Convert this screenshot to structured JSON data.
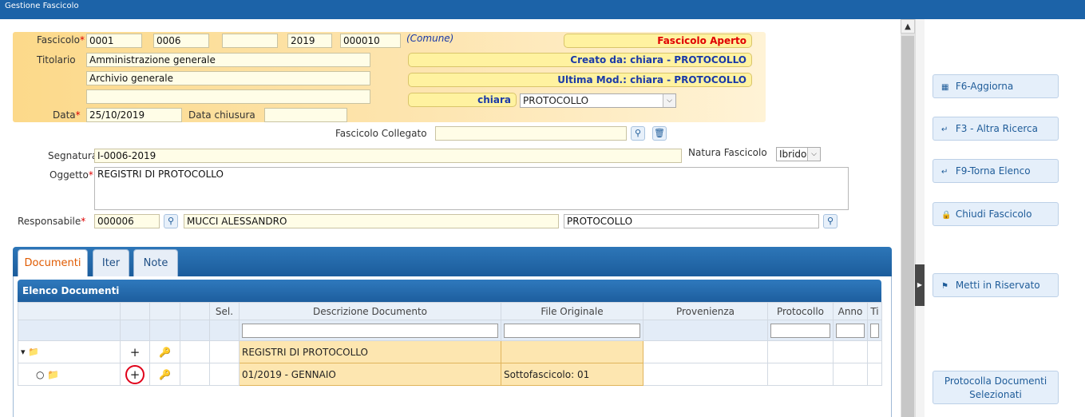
{
  "window": {
    "title": "Gestione Fascicolo"
  },
  "header": {
    "fascicolo_label": "Fascicolo",
    "fascicolo_1": "0001",
    "fascicolo_2": "0006",
    "fascicolo_3": "",
    "anno": "2019",
    "numero": "000010",
    "comune": "(Comune)",
    "stato": "Fascicolo Aperto",
    "titolario_label": "Titolario",
    "titolario_1": "Amministrazione generale",
    "titolario_2": "Archivio generale",
    "titolario_3": "",
    "creato_da": "Creato da: chiara - PROTOCOLLO",
    "ultima_mod": "Ultima Mod.: chiara - PROTOCOLLO",
    "utente": "chiara",
    "ufficio_select": "PROTOCOLLO",
    "data_label": "Data",
    "data_value": "25/10/2019",
    "data_chiusura_label": "Data chiusura",
    "data_chiusura_value": ""
  },
  "form": {
    "collegato_label": "Fascicolo Collegato",
    "collegato_value": "",
    "segnatura_label": "Segnatura",
    "segnatura_value": "I-0006-2019",
    "natura_label": "Natura Fascicolo",
    "natura_value": "Ibrido",
    "oggetto_label": "Oggetto",
    "oggetto_value": "REGISTRI DI PROTOCOLLO",
    "responsabile_label": "Responsabile",
    "responsabile_code": "000006",
    "responsabile_name": "MUCCI ALESSANDRO",
    "responsabile_ufficio": "PROTOCOLLO"
  },
  "tabs": [
    {
      "label": "Documenti",
      "active": true
    },
    {
      "label": "Iter",
      "active": false
    },
    {
      "label": "Note",
      "active": false
    }
  ],
  "grid": {
    "title": "Elenco Documenti",
    "columns": [
      "",
      "",
      "",
      "",
      "Sel.",
      "Descrizione Documento",
      "File Originale",
      "Provenienza",
      "Protocollo",
      "Anno",
      "Ti"
    ],
    "rows": [
      {
        "descrizione": "REGISTRI DI PROTOCOLLO",
        "file": "",
        "provenienza": "",
        "protocollo": "",
        "anno": ""
      },
      {
        "descrizione": "01/2019 - GENNAIO",
        "file": "Sottofascicolo: 01",
        "provenienza": "",
        "protocollo": "",
        "anno": ""
      }
    ]
  },
  "actions": {
    "aggiorna": "F6-Aggiorna",
    "altra_ricerca": "F3 - Altra Ricerca",
    "torna_elenco": "F9-Torna Elenco",
    "chiudi": "Chiudi Fascicolo",
    "riservato": "Metti in Riservato",
    "protocolla_1": "Protocolla Documenti",
    "protocolla_2": "Selezionati"
  },
  "colors": {
    "titlebar": "#1c63a8",
    "accent_red": "#e00000",
    "accent_blue": "#1a3aa8",
    "highlight_circle": "#e0001a"
  }
}
